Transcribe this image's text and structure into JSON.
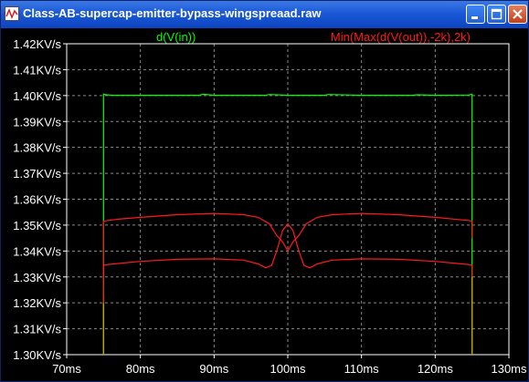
{
  "window": {
    "title": "Class-AB-supercap-emitter-bypass-wingspreaad.raw",
    "icon": "waveform-icon",
    "buttons": {
      "minimize": "minimize-icon",
      "maximize": "maximize-icon",
      "close": "close-icon"
    }
  },
  "colors": {
    "background": "#000000",
    "axis": "#ffffff",
    "grid": "#8a8a8a",
    "trace_vin": "#00ff00",
    "trace_vout": "#ff1a1a",
    "edge_overlap": "#c8a000"
  },
  "chart_data": {
    "type": "line",
    "title": "",
    "xlabel": "",
    "ylabel": "",
    "grid": true,
    "xlim": [
      70,
      130
    ],
    "ylim": [
      1.3,
      1.42
    ],
    "x_unit": "ms",
    "y_unit": "KV/s",
    "x_ticks": [
      "70ms",
      "80ms",
      "90ms",
      "100ms",
      "110ms",
      "120ms",
      "130ms"
    ],
    "y_ticks": [
      "1.42KV/s",
      "1.41KV/s",
      "1.40KV/s",
      "1.39KV/s",
      "1.38KV/s",
      "1.37KV/s",
      "1.36KV/s",
      "1.35KV/s",
      "1.34KV/s",
      "1.33KV/s",
      "1.32KV/s",
      "1.31KV/s",
      "1.30KV/s"
    ],
    "legend": [
      {
        "label": "d(V(in))",
        "color": "#00ff00",
        "position": "top-left"
      },
      {
        "label": "Min(Max(d(V(out)),-2k),2k)",
        "color": "#ff1a1a",
        "position": "top-right"
      }
    ],
    "series": [
      {
        "name": "d(V(in))",
        "color": "#00ff00",
        "x": [
          75.0,
          75.0,
          75.4,
          76.2,
          80,
          85,
          88,
          88.5,
          90,
          95,
          97,
          97.5,
          100,
          103,
          105,
          105.5,
          110,
          115,
          117,
          117.5,
          120,
          124.5,
          125.0,
          125.0
        ],
        "y": [
          1.3,
          1.4005,
          1.4003,
          1.4001,
          1.4001,
          1.4001,
          1.4001,
          1.4005,
          1.4001,
          1.4001,
          1.4001,
          1.4004,
          1.4001,
          1.4001,
          1.4001,
          1.4004,
          1.4001,
          1.4001,
          1.4001,
          1.4003,
          1.4001,
          1.4002,
          1.4005,
          1.3
        ]
      },
      {
        "name": "Min(Max(d(V(out)),-2k),2k) upper",
        "color": "#ff1a1a",
        "x": [
          75.0,
          75.0,
          75.6,
          77,
          80,
          85,
          90,
          94,
          96,
          97.5,
          98.5,
          99.3,
          100,
          100.7,
          101.5,
          102.5,
          104,
          106,
          110,
          115,
          120,
          123,
          124.5,
          125.0,
          125.0
        ],
        "y": [
          1.33,
          1.3515,
          1.3518,
          1.3523,
          1.353,
          1.354,
          1.3545,
          1.354,
          1.353,
          1.3505,
          1.346,
          1.3435,
          1.34,
          1.3435,
          1.346,
          1.3505,
          1.353,
          1.354,
          1.3545,
          1.354,
          1.353,
          1.3522,
          1.3518,
          1.3515,
          1.345
        ]
      },
      {
        "name": "Min(Max(d(V(out)),-2k),2k) lower",
        "color": "#ff1a1a",
        "x": [
          75.0,
          75.0,
          75.6,
          77,
          80,
          85,
          90,
          94,
          96,
          97,
          97.8,
          98.5,
          99.3,
          100,
          100.7,
          101.5,
          102.2,
          103,
          104,
          106,
          110,
          115,
          120,
          123,
          124.5,
          125.0,
          125.0
        ],
        "y": [
          1.32,
          1.3345,
          1.3348,
          1.3352,
          1.336,
          1.3368,
          1.337,
          1.3365,
          1.335,
          1.3335,
          1.3345,
          1.34,
          1.348,
          1.3505,
          1.348,
          1.34,
          1.3345,
          1.3335,
          1.335,
          1.3365,
          1.337,
          1.3368,
          1.336,
          1.3352,
          1.3348,
          1.3345,
          1.33
        ]
      }
    ]
  }
}
